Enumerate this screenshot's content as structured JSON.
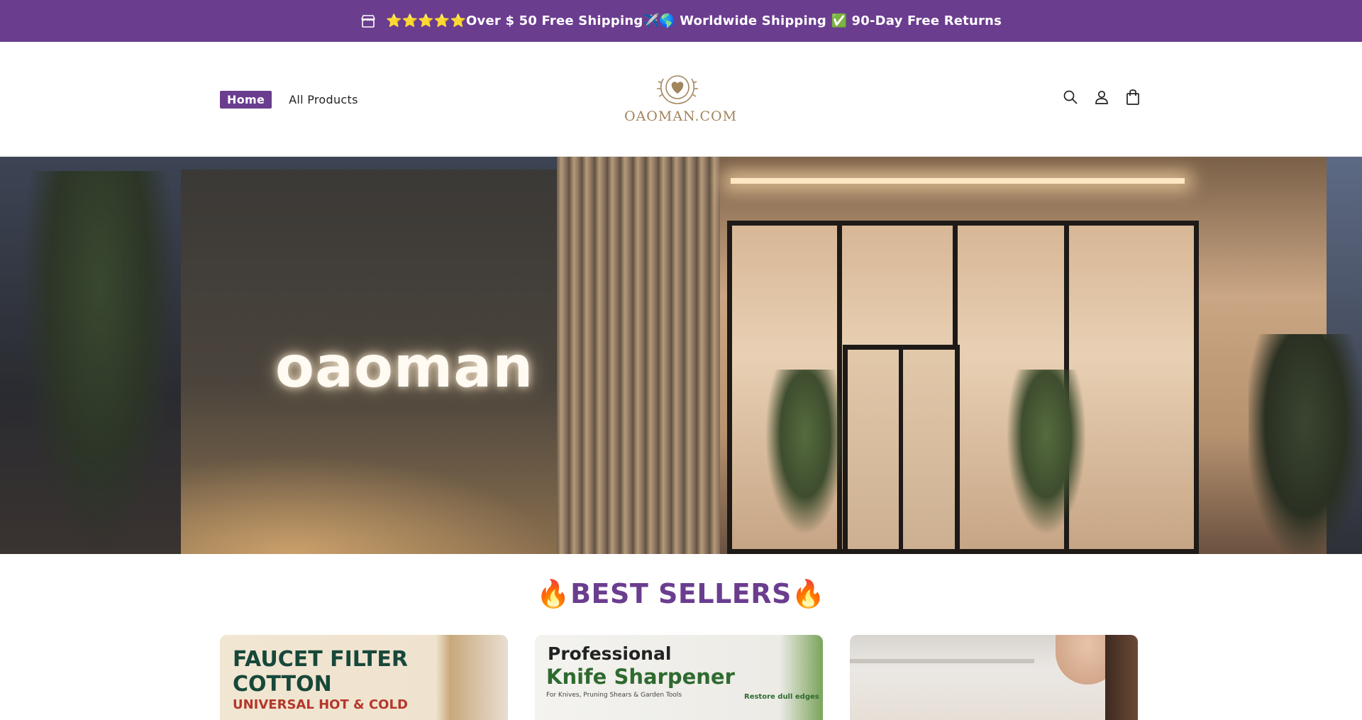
{
  "announcement": {
    "text": "⭐⭐⭐⭐⭐Over $ 50 Free Shipping✈️🌎 Worldwide Shipping ✅ 90-Day Free Returns"
  },
  "header": {
    "nav": [
      {
        "label": "Home",
        "active": true
      },
      {
        "label": "All Products",
        "active": false
      }
    ],
    "logo_text": "OAOMAN.COM",
    "icons": [
      "search-icon",
      "account-icon",
      "cart-icon"
    ]
  },
  "hero": {
    "sign_text": "oaoman"
  },
  "best_sellers": {
    "title": "🔥BEST SELLERS🔥",
    "cards": [
      {
        "lines": [
          "FAUCET FILTER",
          "COTTON",
          "UNIVERSAL HOT & COLD"
        ]
      },
      {
        "lines": [
          "Professional",
          "Knife Sharpener",
          "For Knives, Pruning Shears & Garden Tools",
          "Restore dull edges"
        ]
      },
      {
        "lines": []
      }
    ]
  },
  "colors": {
    "brand_purple": "#6b3d8f",
    "logo_gold": "#a1855c"
  }
}
